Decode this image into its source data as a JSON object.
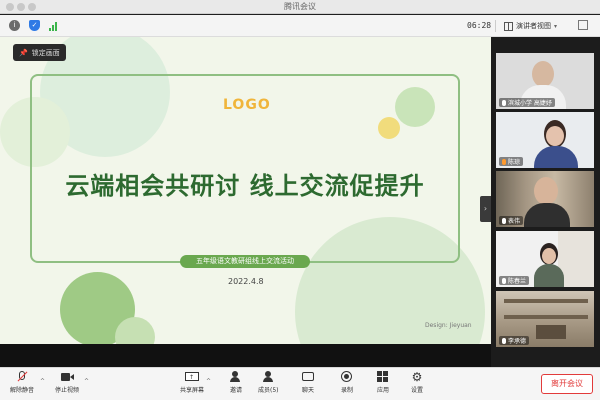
{
  "window": {
    "title": "腾讯会议"
  },
  "topbar": {
    "clock": "06:28",
    "view_label": "演讲者视图",
    "info_icon": "info-icon",
    "shield_icon": "shield-icon",
    "signal_icon": "signal-icon"
  },
  "stage": {
    "lock_label": "锁定画面",
    "slide": {
      "logo": "LOGO",
      "headline": "云端相会共研讨  线上交流促提升",
      "subtitle": "五年级语文教研组线上交流活动",
      "date": "2022.4.8",
      "credit": "Design: Jieyuan"
    }
  },
  "gallery": {
    "participants": [
      {
        "name": "滨城小学 高婕妤"
      },
      {
        "name": "陈琼"
      },
      {
        "name": "表伟"
      },
      {
        "name": "陈春兰"
      },
      {
        "name": "李承德"
      }
    ]
  },
  "toolbar": {
    "items": [
      {
        "label": "解除静音",
        "icon": "mic-muted-icon"
      },
      {
        "label": "停止视频",
        "icon": "camera-icon"
      },
      {
        "label": "共享屏幕",
        "icon": "share-screen-icon"
      },
      {
        "label": "邀请",
        "icon": "invite-icon"
      },
      {
        "label": "成员(5)",
        "icon": "members-icon"
      },
      {
        "label": "聊天",
        "icon": "chat-icon"
      },
      {
        "label": "录制",
        "icon": "record-icon"
      },
      {
        "label": "应用",
        "icon": "apps-icon"
      },
      {
        "label": "设置",
        "icon": "gear-icon"
      }
    ],
    "leave_label": "离开会议"
  },
  "colors": {
    "accent": "#2f7ae5",
    "leave": "#e23b3b",
    "slide_green": "#2d6a30",
    "logo": "#f0b53b"
  }
}
